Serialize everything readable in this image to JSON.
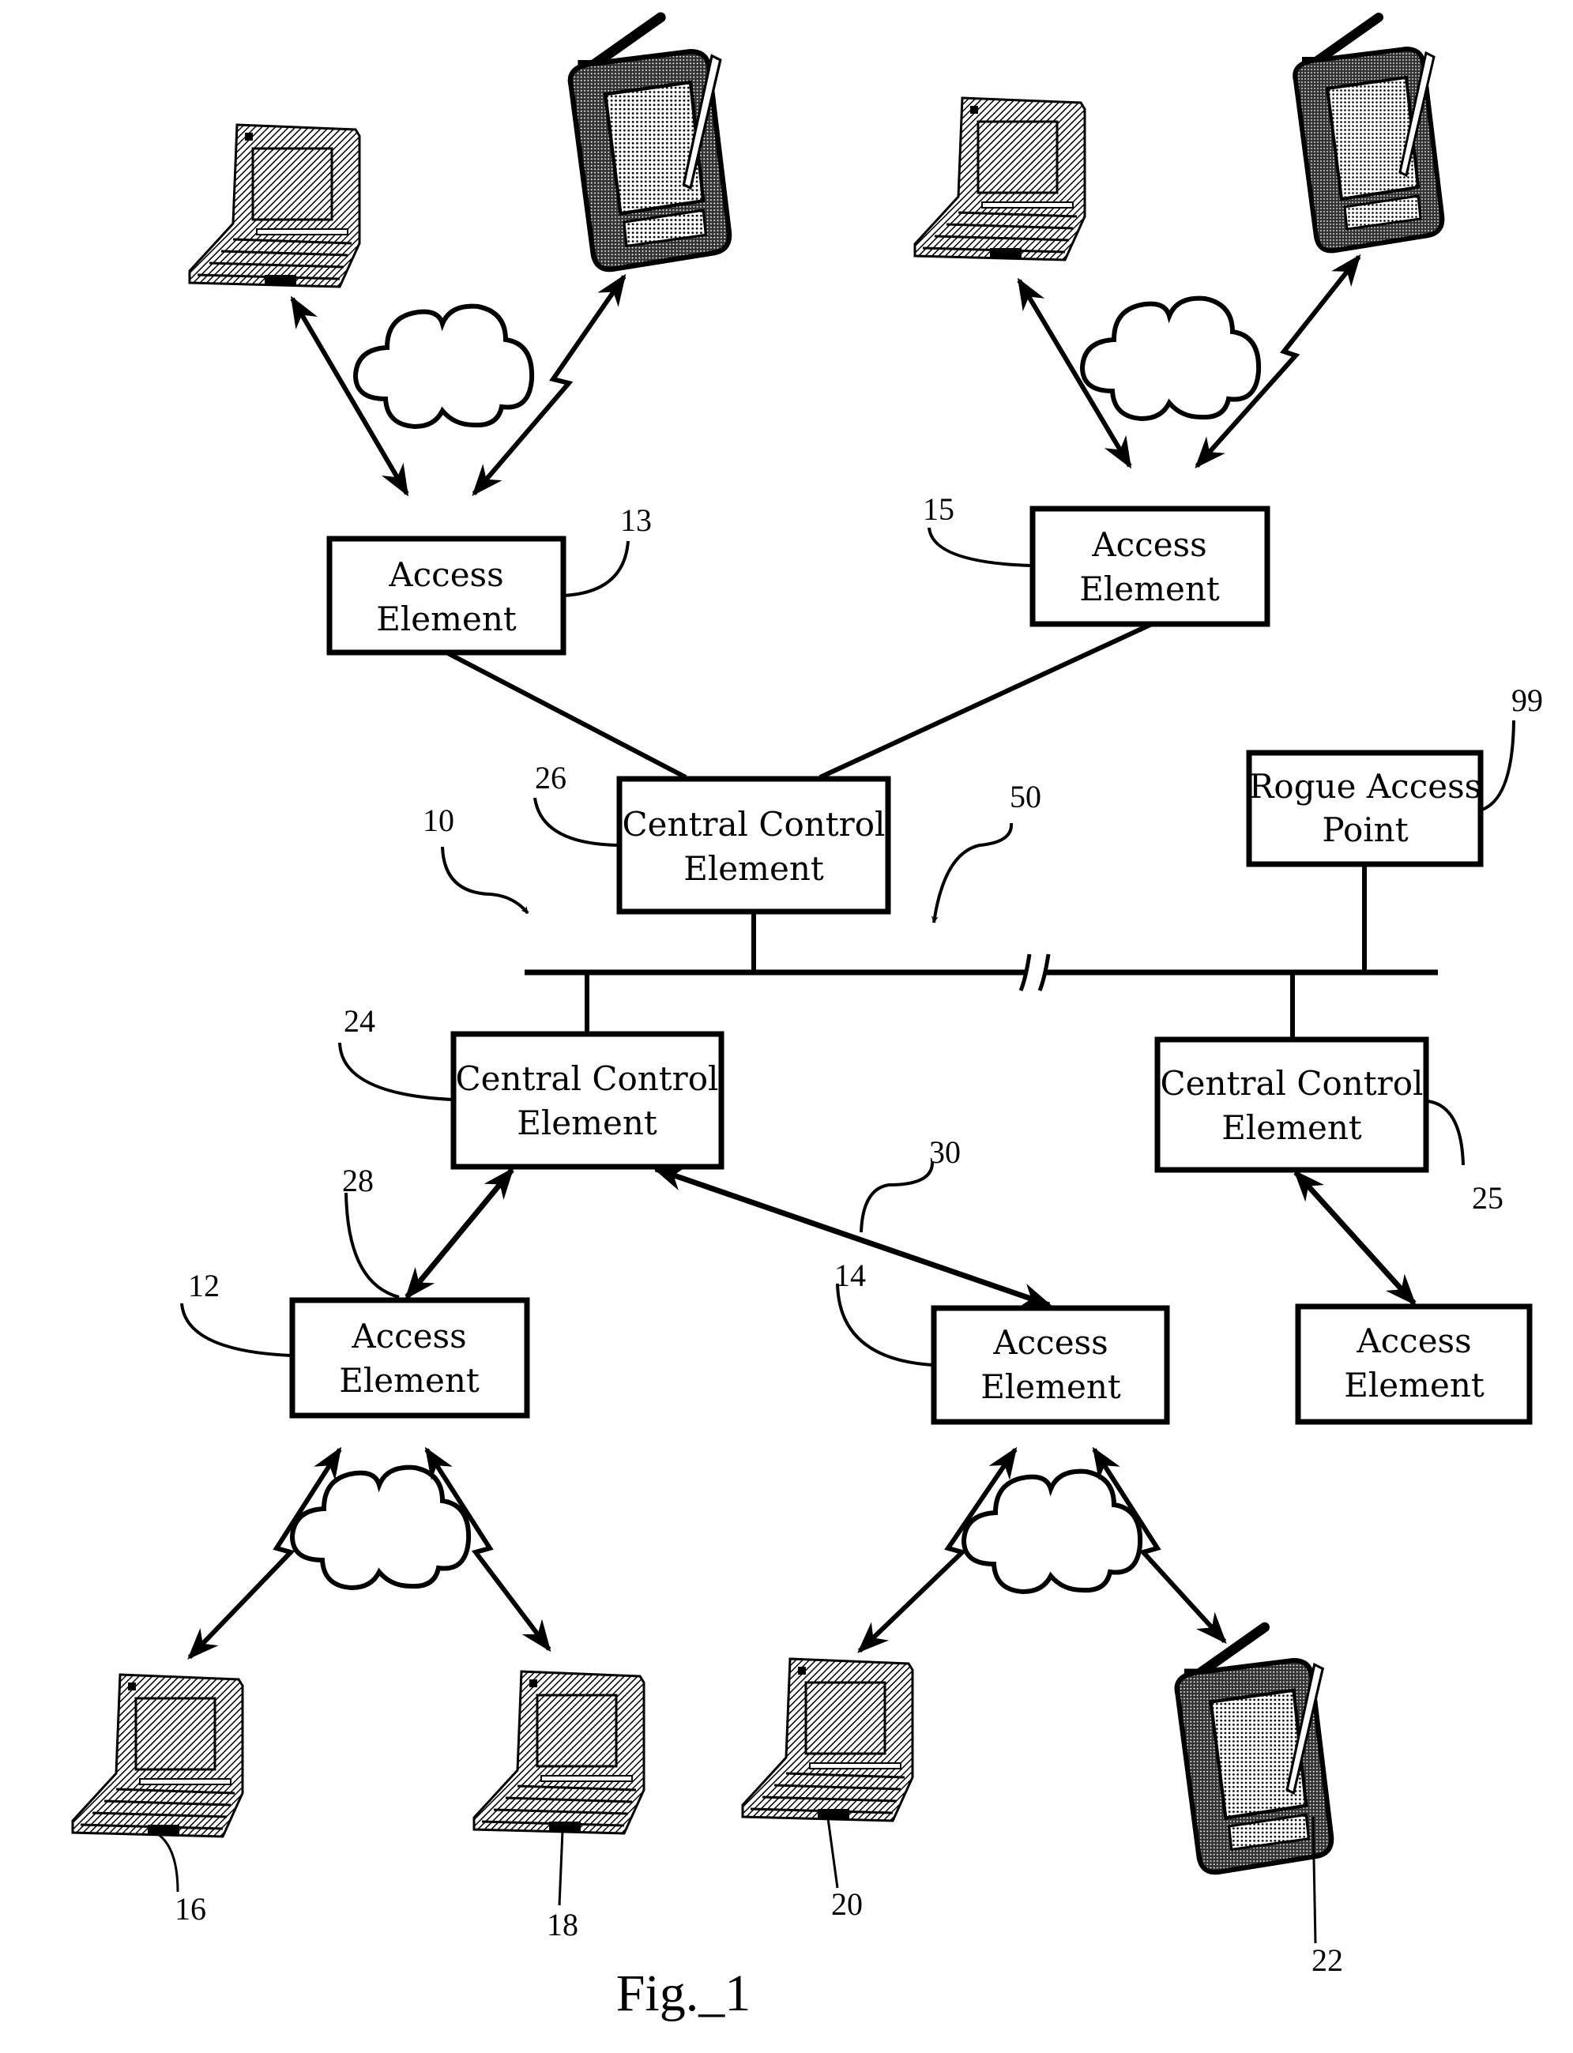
{
  "figure": {
    "caption": "Fig._1",
    "reference_numerals": {
      "system": "10",
      "network": "50",
      "access_element_12": "12",
      "access_element_13": "13",
      "access_element_14": "14",
      "access_element_15": "15",
      "client_16": "16",
      "client_18": "18",
      "client_20": "20",
      "client_22": "22",
      "central_control_24": "24",
      "central_control_25": "25",
      "central_control_26": "26",
      "link_28": "28",
      "link_30": "30",
      "rogue_99": "99"
    }
  },
  "boxes": {
    "access_13": {
      "line1": "Access",
      "line2": "Element"
    },
    "access_15": {
      "line1": "Access",
      "line2": "Element"
    },
    "central_26": {
      "line1": "Central Control",
      "line2": "Element"
    },
    "rogue_99": {
      "line1": "Rogue Access",
      "line2": "Point"
    },
    "central_24": {
      "line1": "Central Control",
      "line2": "Element"
    },
    "central_25": {
      "line1": "Central Control",
      "line2": "Element"
    },
    "access_12": {
      "line1": "Access",
      "line2": "Element"
    },
    "access_14": {
      "line1": "Access",
      "line2": "Element"
    },
    "access_right": {
      "line1": "Access",
      "line2": "Element"
    }
  },
  "devices": [
    {
      "type": "laptop",
      "group": "top-left"
    },
    {
      "type": "pda",
      "group": "top-left"
    },
    {
      "type": "laptop",
      "group": "top-right"
    },
    {
      "type": "pda",
      "group": "top-right"
    },
    {
      "type": "laptop",
      "ref": "16"
    },
    {
      "type": "laptop",
      "ref": "18"
    },
    {
      "type": "laptop",
      "ref": "20"
    },
    {
      "type": "pda",
      "ref": "22"
    }
  ]
}
